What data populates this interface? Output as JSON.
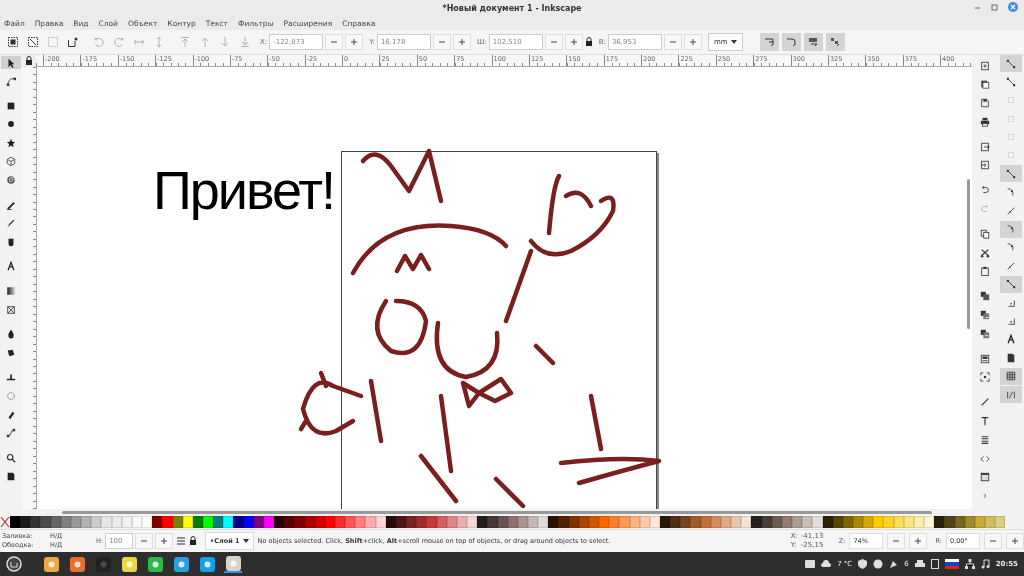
{
  "window": {
    "title": "*Новый документ 1 - Inkscape"
  },
  "menu": [
    "Файл",
    "Правка",
    "Вид",
    "Слой",
    "Объект",
    "Контур",
    "Текст",
    "Фильтры",
    "Расширения",
    "Справка"
  ],
  "toolbar": {
    "commands": [
      {
        "kind": "select-all",
        "disabled": false
      },
      {
        "kind": "select-layers",
        "disabled": false
      },
      {
        "kind": "deselect",
        "disabled": true
      },
      {
        "kind": "touch",
        "disabled": false
      },
      {
        "kind": "rotate-ccw",
        "disabled": true
      },
      {
        "kind": "rotate-cw",
        "disabled": true
      },
      {
        "kind": "flip-h",
        "disabled": true
      },
      {
        "kind": "flip-v",
        "disabled": true
      },
      {
        "kind": "top",
        "disabled": true
      },
      {
        "kind": "up",
        "disabled": true
      },
      {
        "kind": "down",
        "disabled": true
      },
      {
        "kind": "bottom",
        "disabled": true
      }
    ],
    "fields": [
      {
        "label": "X:",
        "value": "-122,873"
      },
      {
        "label": "Y:",
        "value": "16,178"
      },
      {
        "label": "Ш:",
        "value": "102,510"
      },
      {
        "label": "В:",
        "value": "36,953"
      }
    ],
    "unit": "mm",
    "toggles": [
      {
        "kind": "scale-stroke",
        "on": true
      },
      {
        "kind": "scale-corners",
        "on": true
      },
      {
        "kind": "move-gradient",
        "on": true
      },
      {
        "kind": "move-pattern",
        "on": true
      }
    ]
  },
  "ruler": {
    "labels": [
      "-200",
      "-175",
      "-150",
      "-125",
      "-100",
      "-75",
      "-50",
      "-25",
      "0",
      "25",
      "50",
      "75",
      "100",
      "125",
      "150",
      "175",
      "200",
      "225",
      "250",
      "275",
      "300",
      "325",
      "350",
      "375",
      "400"
    ]
  },
  "tools": [
    {
      "kind": "pointer",
      "selected": true
    },
    {
      "kind": "nodes",
      "selected": false
    },
    {
      "kind": "square",
      "selected": false
    },
    {
      "kind": "circle",
      "selected": false
    },
    {
      "kind": "star",
      "selected": false
    },
    {
      "kind": "cube",
      "selected": false
    },
    {
      "kind": "spiral",
      "selected": false
    },
    {
      "kind": "pencil",
      "selected": false
    },
    {
      "kind": "pen",
      "selected": false
    },
    {
      "kind": "brush",
      "selected": false
    },
    {
      "kind": "text",
      "selected": false
    },
    {
      "kind": "gradient",
      "selected": false
    },
    {
      "kind": "mesh",
      "selected": false
    },
    {
      "kind": "dropper",
      "selected": false
    },
    {
      "kind": "bucket",
      "selected": false
    },
    {
      "kind": "stamp",
      "selected": false
    },
    {
      "kind": "spray",
      "selected": false
    },
    {
      "kind": "eraser",
      "selected": false
    },
    {
      "kind": "connector",
      "selected": false
    },
    {
      "kind": "zoom",
      "selected": false
    },
    {
      "kind": "measure",
      "selected": false
    }
  ],
  "canvas": {
    "text": "Привет!"
  },
  "commands_bar": [
    {
      "kind": "new",
      "disabled": false
    },
    {
      "kind": "open",
      "disabled": false
    },
    {
      "kind": "save",
      "disabled": false
    },
    {
      "kind": "printer",
      "disabled": false
    },
    {
      "kind": "import",
      "disabled": false
    },
    {
      "kind": "export",
      "disabled": false
    },
    {
      "kind": "undo",
      "disabled": false
    },
    {
      "kind": "redo",
      "disabled": true
    },
    {
      "kind": "copy",
      "disabled": false
    },
    {
      "kind": "cut",
      "disabled": false
    },
    {
      "kind": "paste",
      "disabled": false
    },
    {
      "kind": "duplicate",
      "disabled": false
    },
    {
      "kind": "clone",
      "disabled": false
    },
    {
      "kind": "unlink",
      "disabled": false
    },
    {
      "kind": "group",
      "disabled": false
    },
    {
      "kind": "ungroup",
      "disabled": false
    },
    {
      "kind": "line",
      "disabled": false
    },
    {
      "kind": "text-t",
      "disabled": false
    },
    {
      "kind": "align",
      "disabled": false
    },
    {
      "kind": "code",
      "disabled": false
    },
    {
      "kind": "window",
      "disabled": false
    },
    {
      "kind": "chevron",
      "disabled": false
    }
  ],
  "snap_bar": [
    {
      "kind": "snap",
      "on": true,
      "disabled": false
    },
    {
      "kind": "snap",
      "on": false,
      "disabled": false
    },
    {
      "kind": "box",
      "on": false,
      "disabled": true
    },
    {
      "kind": "box",
      "on": false,
      "disabled": true
    },
    {
      "kind": "box",
      "on": false,
      "disabled": true
    },
    {
      "kind": "box",
      "on": false,
      "disabled": true
    },
    {
      "kind": "snap",
      "on": true,
      "disabled": false
    },
    {
      "kind": "curve",
      "on": false,
      "disabled": false
    },
    {
      "kind": "path",
      "on": false,
      "disabled": false
    },
    {
      "kind": "curve",
      "on": true,
      "disabled": false
    },
    {
      "kind": "curve",
      "on": false,
      "disabled": false
    },
    {
      "kind": "path",
      "on": false,
      "disabled": false
    },
    {
      "kind": "snap",
      "on": true,
      "disabled": false
    },
    {
      "kind": "dot",
      "on": false,
      "disabled": false
    },
    {
      "kind": "dot",
      "on": false,
      "disabled": false
    },
    {
      "kind": "text",
      "on": false,
      "disabled": false
    },
    {
      "kind": "page",
      "on": false,
      "disabled": false
    },
    {
      "kind": "grid",
      "on": true,
      "disabled": false
    },
    {
      "kind": "guide",
      "on": true,
      "disabled": false
    }
  ],
  "palette": {
    "swatches": [
      {
        "color": "#000000"
      },
      {
        "color": "#1a1a1a"
      },
      {
        "color": "#333333"
      },
      {
        "color": "#4d4d4d"
      },
      {
        "color": "#666666"
      },
      {
        "color": "#808080"
      },
      {
        "color": "#999999"
      },
      {
        "color": "#b3b3b3"
      },
      {
        "color": "#cccccc"
      },
      {
        "color": "#e6e6e6"
      },
      {
        "color": "#ececec"
      },
      {
        "color": "#f2f2f2"
      },
      {
        "color": "#f8f8f8"
      },
      {
        "color": "#ffffff"
      },
      {
        "color": "#800000"
      },
      {
        "color": "#ff0000"
      },
      {
        "color": "#808000"
      },
      {
        "color": "#ffff00"
      },
      {
        "color": "#008000"
      },
      {
        "color": "#00ff00"
      },
      {
        "color": "#008080"
      },
      {
        "color": "#00ffff"
      },
      {
        "color": "#000080"
      },
      {
        "color": "#0000ff"
      },
      {
        "color": "#800080"
      },
      {
        "color": "#ff00ff"
      },
      {
        "color": "#2b0000"
      },
      {
        "color": "#550000"
      },
      {
        "color": "#800000"
      },
      {
        "color": "#aa0000"
      },
      {
        "color": "#d40000"
      },
      {
        "color": "#ff0000"
      },
      {
        "color": "#ff2a2a"
      },
      {
        "color": "#ff5555"
      },
      {
        "color": "#ff8080"
      },
      {
        "color": "#ffaaaa"
      },
      {
        "color": "#ffd5d5"
      },
      {
        "color": "#280b0b"
      },
      {
        "color": "#501616"
      },
      {
        "color": "#782121"
      },
      {
        "color": "#a02c2c"
      },
      {
        "color": "#c83737"
      },
      {
        "color": "#d35f5f"
      },
      {
        "color": "#de8787"
      },
      {
        "color": "#e9afaf"
      },
      {
        "color": "#f4d7d7"
      },
      {
        "color": "#241c1c"
      },
      {
        "color": "#483737"
      },
      {
        "color": "#6c5353"
      },
      {
        "color": "#916f6f"
      },
      {
        "color": "#ac9393"
      },
      {
        "color": "#c8b7b7"
      },
      {
        "color": "#e3dbdb"
      },
      {
        "color": "#2b1100"
      },
      {
        "color": "#552200"
      },
      {
        "color": "#803300"
      },
      {
        "color": "#aa4400"
      },
      {
        "color": "#d45500"
      },
      {
        "color": "#ff6600"
      },
      {
        "color": "#ff7f2a"
      },
      {
        "color": "#ff9955"
      },
      {
        "color": "#ffb380"
      },
      {
        "color": "#ffccaa"
      },
      {
        "color": "#ffe6d5"
      },
      {
        "color": "#28170b"
      },
      {
        "color": "#502d16"
      },
      {
        "color": "#784421"
      },
      {
        "color": "#a05a2c"
      },
      {
        "color": "#c87137"
      },
      {
        "color": "#d38d5f"
      },
      {
        "color": "#deaa87"
      },
      {
        "color": "#e9c6af"
      },
      {
        "color": "#f4e3d7"
      },
      {
        "color": "#241f1c"
      },
      {
        "color": "#483e37"
      },
      {
        "color": "#6c5d53"
      },
      {
        "color": "#917c6f"
      },
      {
        "color": "#ac9d93"
      },
      {
        "color": "#c8beb7"
      },
      {
        "color": "#e3dedb"
      },
      {
        "color": "#2b2200"
      },
      {
        "color": "#554400"
      },
      {
        "color": "#806600"
      },
      {
        "color": "#aa8800"
      },
      {
        "color": "#d4aa00"
      },
      {
        "color": "#ffcc00"
      },
      {
        "color": "#ffd42a"
      },
      {
        "color": "#ffdd55"
      },
      {
        "color": "#ffe680"
      },
      {
        "color": "#ffeeaa"
      },
      {
        "color": "#fff6d5"
      },
      {
        "color": "#28220b"
      },
      {
        "color": "#504416"
      },
      {
        "color": "#786721"
      },
      {
        "color": "#a0892c"
      },
      {
        "color": "#c8ab37"
      },
      {
        "color": "#d3bc5f"
      },
      {
        "color": "#decd87"
      }
    ]
  },
  "status": {
    "fill_label": "Заливка:",
    "fill_value": "Н/Д",
    "stroke_label": "Обводка:",
    "stroke_value": "Н/Д",
    "opacity_label": "Н:",
    "opacity_value": "100",
    "layer": "•Слой 1",
    "message": "No objects selected. Click, **Shift**+click, **Alt**+scroll mouse on top of objects, or drag around objects to select.",
    "x_label": "X:",
    "x_value": "-41,13",
    "y_label": "Y:",
    "y_value": "-25,15",
    "zoom_label": "Z:",
    "zoom_value": "74%",
    "rotate_label": "R:",
    "rotate_value": "0,00°"
  },
  "taskbar": {
    "apps": [
      {
        "kind": "files",
        "active": false
      },
      {
        "kind": "browser",
        "active": false
      },
      {
        "kind": "terminal",
        "active": false
      },
      {
        "kind": "notes",
        "active": false
      },
      {
        "kind": "phone",
        "active": false
      },
      {
        "kind": "plane",
        "active": false
      },
      {
        "kind": "chat",
        "active": false
      },
      {
        "kind": "editor",
        "active": true
      }
    ],
    "weather": "7 °C",
    "updates": "6",
    "clock": "20:55"
  }
}
